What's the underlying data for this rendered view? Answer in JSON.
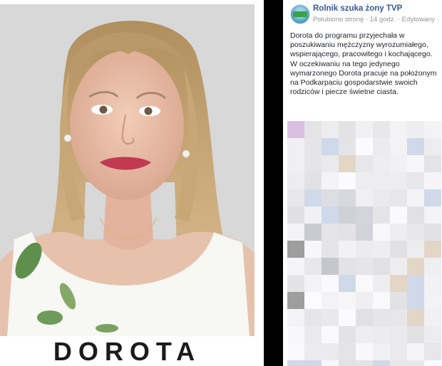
{
  "photo": {
    "name_caption": "DOROTA"
  },
  "post": {
    "page_name": "Rolnik szuka żony TVP",
    "liked_label": "Polubiono stronę",
    "time": "14 godz.",
    "edited_label": "Edytowany",
    "paragraphs": [
      "Dorota do programu przyjechała w poszukiwaniu mężczyzny wyrozumiałego, wspierającego, pracowitego i kochającego.",
      "W oczekiwaniu na tego jedynego wymarzonego Dorota pracuje na położonym na Podkarpaciu gospodarstwie swoich rodziców i piecze świetne ciasta."
    ]
  },
  "colors": {
    "link": "#365899",
    "meta": "#90949c",
    "text": "#1d2129"
  }
}
